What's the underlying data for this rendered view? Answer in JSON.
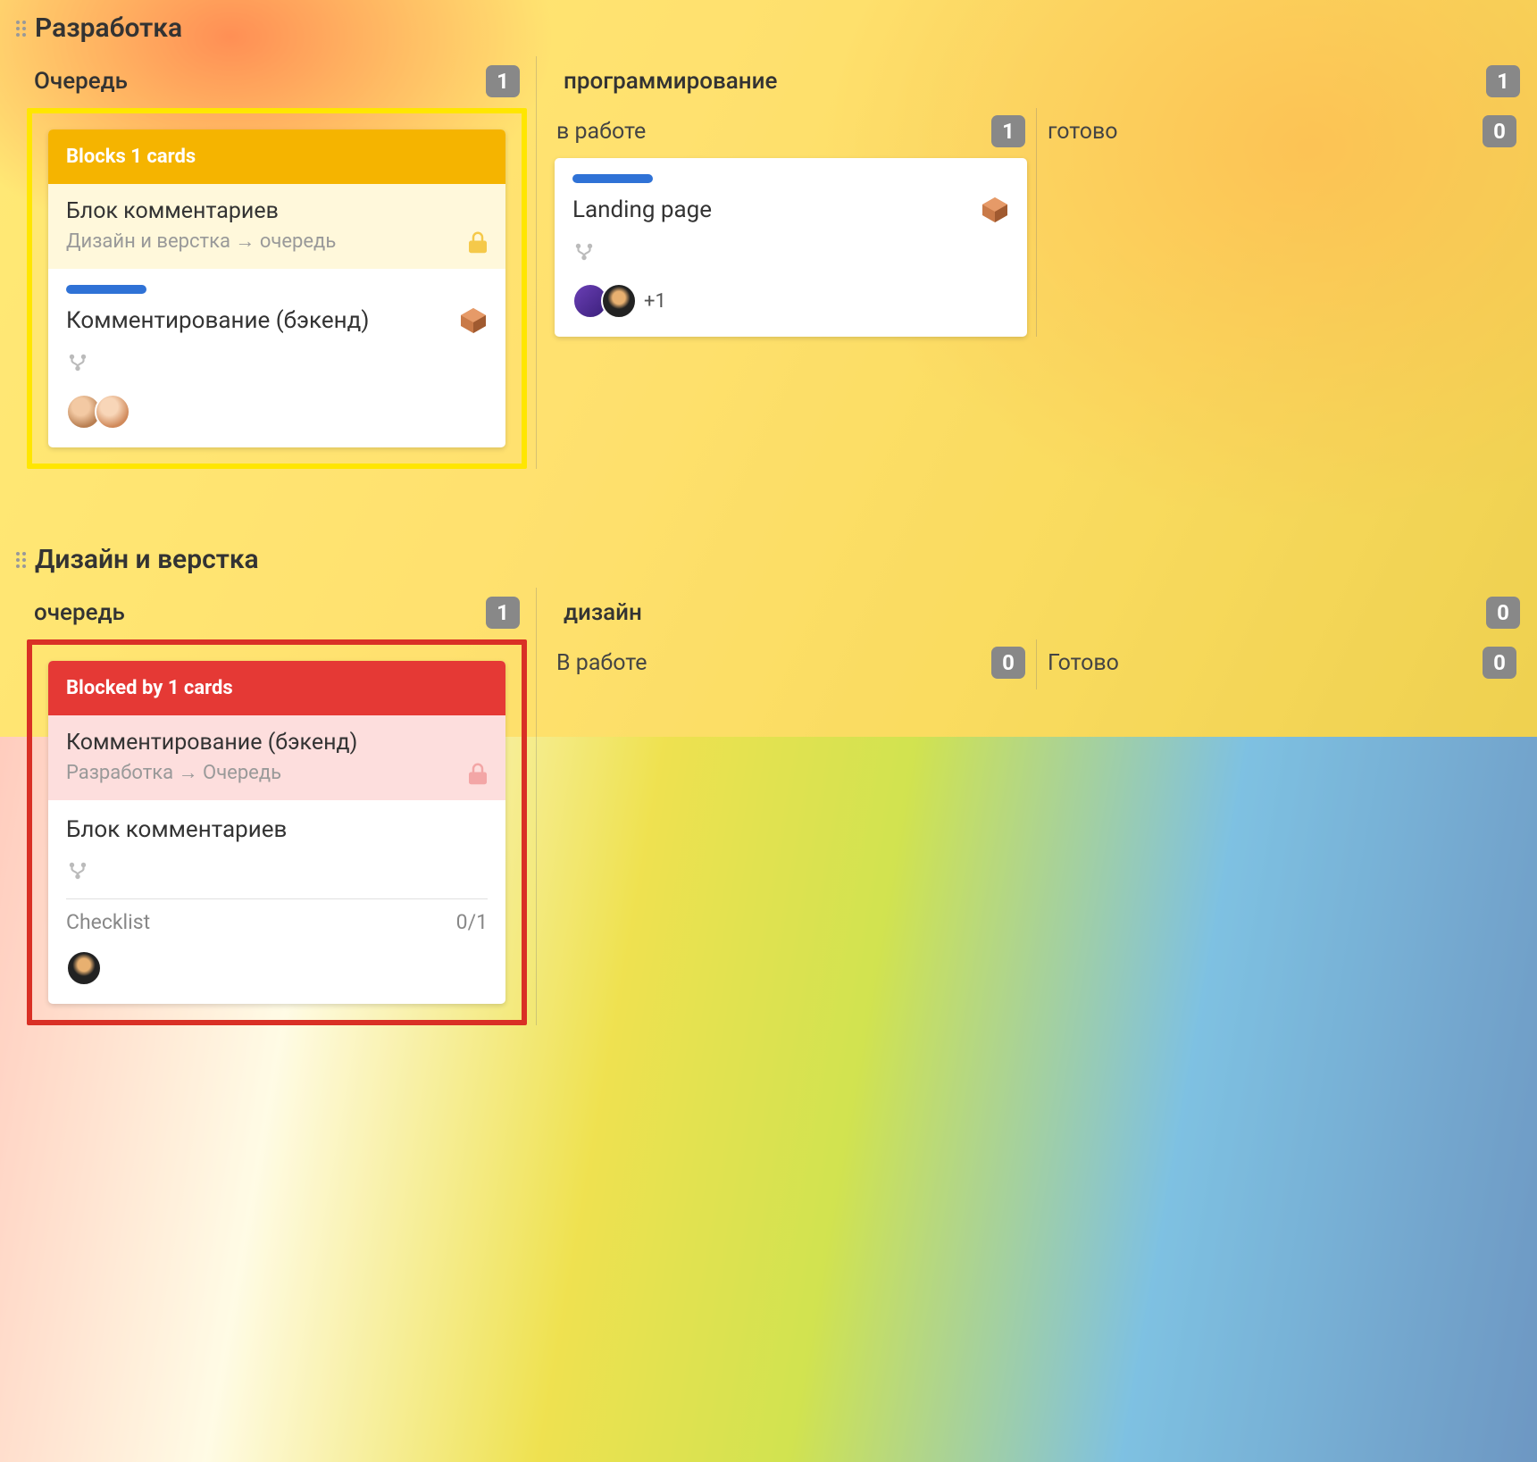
{
  "swimlane1": {
    "title": "Разработка",
    "queue": {
      "title": "Очередь",
      "count": "1",
      "card": {
        "banner": "Blocks 1 cards",
        "rel_title": "Блок комментариев",
        "rel_path": "Дизайн и верстка → очередь",
        "title": "Комментирование (бэкенд)"
      }
    },
    "group": {
      "title": "программирование",
      "count": "1",
      "sub1": {
        "title": "в работе",
        "count": "1",
        "card": {
          "title": "Landing page",
          "more": "+1"
        }
      },
      "sub2": {
        "title": "готово",
        "count": "0"
      }
    }
  },
  "swimlane2": {
    "title": "Дизайн и верстка",
    "queue": {
      "title": "очередь",
      "count": "1",
      "card": {
        "banner": "Blocked by 1 cards",
        "rel_title": "Комментирование (бэкенд)",
        "rel_path": "Разработка → Очередь",
        "title": "Блок комментариев",
        "checklist_label": "Checklist",
        "checklist_count": "0/1"
      }
    },
    "group": {
      "title": "дизайн",
      "count": "0",
      "sub1": {
        "title": "В работе",
        "count": "0"
      },
      "sub2": {
        "title": "Готово",
        "count": "0"
      }
    }
  }
}
